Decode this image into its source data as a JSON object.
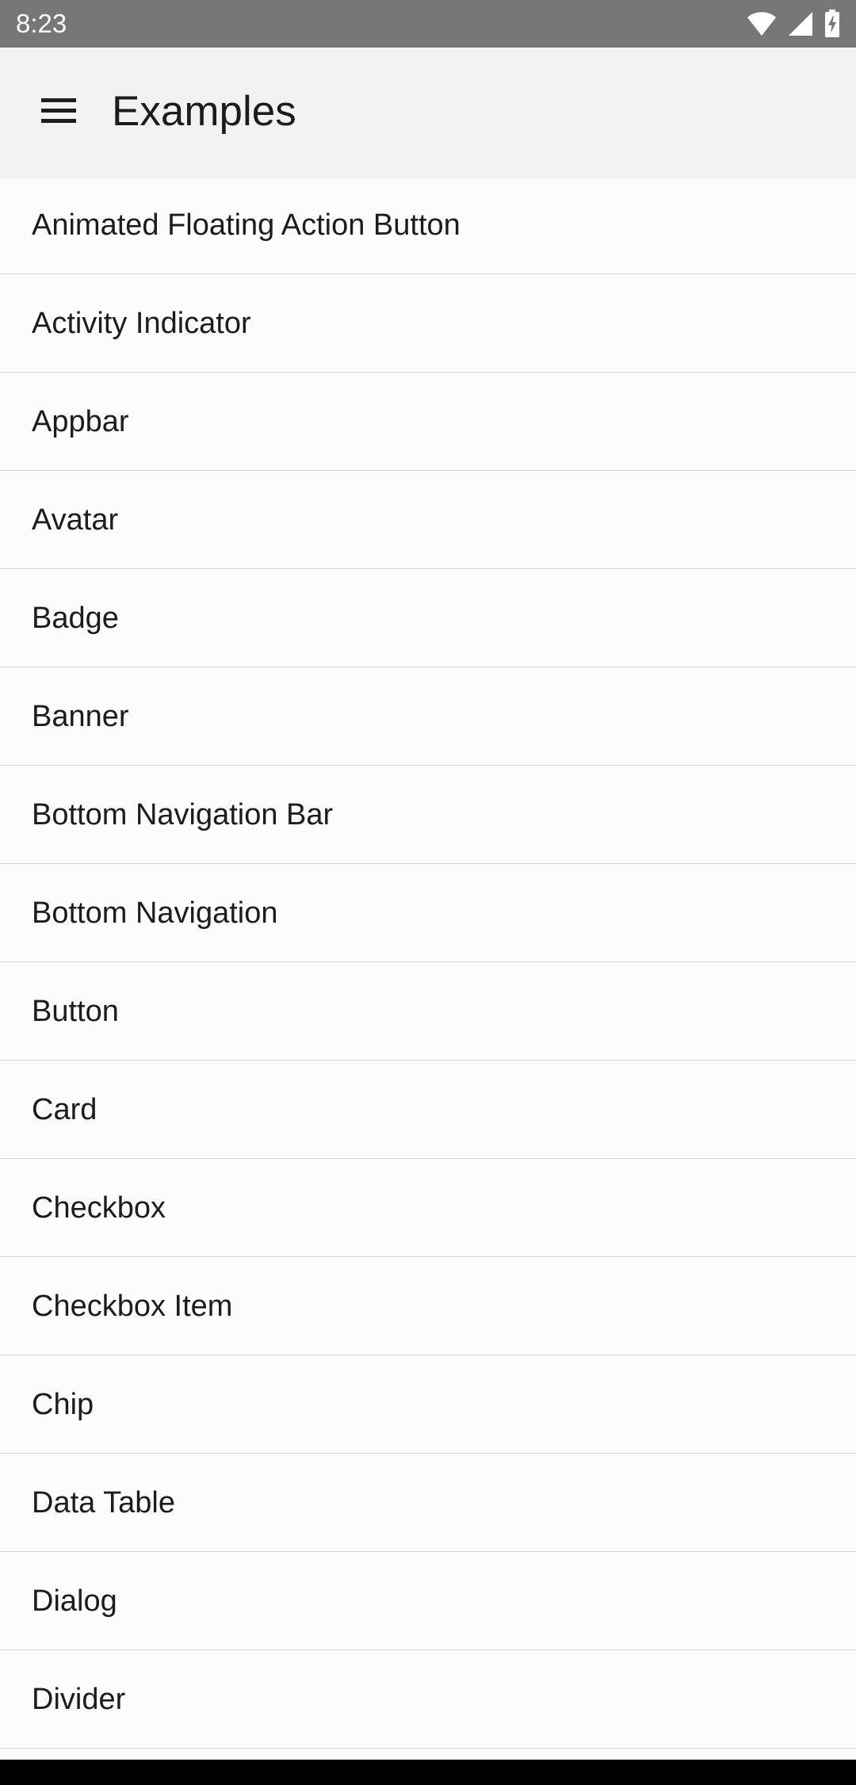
{
  "status_bar": {
    "time": "8:23",
    "icons": [
      "wifi-icon",
      "signal-icon",
      "battery-icon"
    ]
  },
  "app_bar": {
    "title": "Examples",
    "menu_icon": "menu-icon"
  },
  "colors": {
    "status_bar_bg": "#777777",
    "app_bar_bg": "#f3f1f6",
    "background": "#fdfbfe",
    "text": "#1d1b20",
    "divider": "#d6d3da"
  },
  "list": {
    "items": [
      {
        "label": "Animated Floating Action Button"
      },
      {
        "label": "Activity Indicator"
      },
      {
        "label": "Appbar"
      },
      {
        "label": "Avatar"
      },
      {
        "label": "Badge"
      },
      {
        "label": "Banner"
      },
      {
        "label": "Bottom Navigation Bar"
      },
      {
        "label": "Bottom Navigation"
      },
      {
        "label": "Button"
      },
      {
        "label": "Card"
      },
      {
        "label": "Checkbox"
      },
      {
        "label": "Checkbox Item"
      },
      {
        "label": "Chip"
      },
      {
        "label": "Data Table"
      },
      {
        "label": "Dialog"
      },
      {
        "label": "Divider"
      }
    ]
  }
}
